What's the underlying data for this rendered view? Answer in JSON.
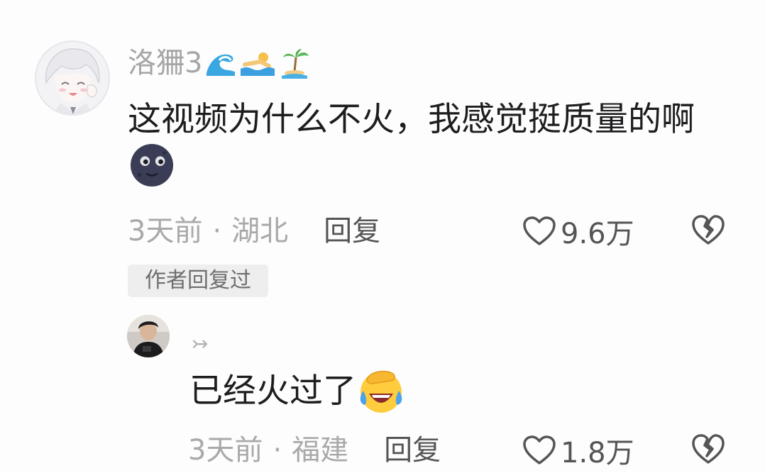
{
  "comment": {
    "username": "洛狦3",
    "username_emoji": [
      "wave-icon",
      "swimmer-icon",
      "island-icon"
    ],
    "text": "这视频为什么不火，我感觉挺质量的啊",
    "text_emoji": "new-moon-face-icon",
    "time": "3天前",
    "dot": "·",
    "location": "湖北",
    "reply_label": "回复",
    "likes": "9.6万",
    "author_badge": "作者回复过"
  },
  "reply": {
    "arrow": "↣",
    "text": "已经火过了",
    "text_emoji": "laughing-tears-face-icon",
    "time": "3天前",
    "dot": "·",
    "location": "福建",
    "reply_label": "回复",
    "likes": "1.8万"
  },
  "colors": {
    "meta_gray": "#a9a9a9",
    "action_gray": "#555555",
    "badge_bg": "#eeeeee",
    "text_dark": "#1d1d1f"
  }
}
